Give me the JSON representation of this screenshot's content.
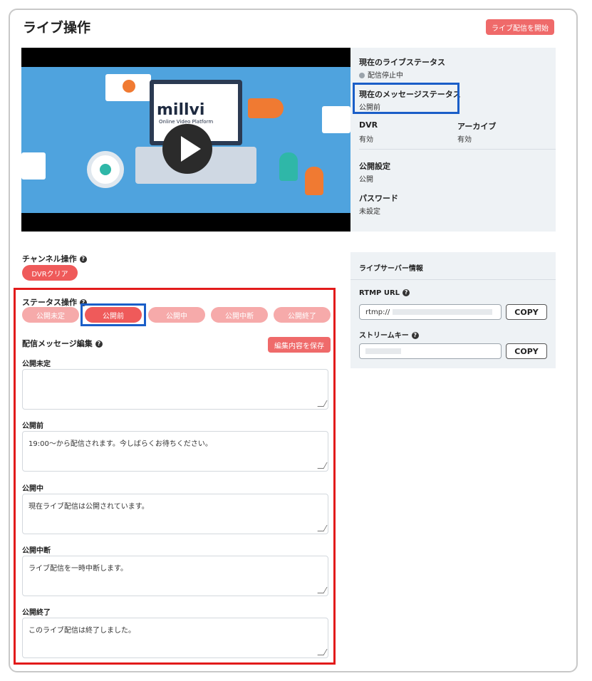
{
  "page": {
    "title": "ライブ操作",
    "start_button": "ライブ配信を開始"
  },
  "video": {
    "brand": "millvi",
    "brand_sub": "Online Video Platform"
  },
  "info": {
    "live_status_label": "現在のライブステータス",
    "live_status_value": "配信停止中",
    "message_status_label": "現在のメッセージステータス",
    "message_status_value": "公開前",
    "dvr_label": "DVR",
    "dvr_value": "有効",
    "archive_label": "アーカイブ",
    "archive_value": "有効",
    "publish_label": "公開設定",
    "publish_value": "公開",
    "password_label": "パスワード",
    "password_value": "未設定"
  },
  "channel": {
    "title": "チャンネル操作",
    "dvr_clear": "DVRクリア"
  },
  "status_ops": {
    "title": "ステータス操作",
    "buttons": [
      "公開未定",
      "公開前",
      "公開中",
      "公開中断",
      "公開終了"
    ]
  },
  "message_edit": {
    "title": "配信メッセージ編集",
    "save_button": "編集内容を保存",
    "fields": [
      {
        "label": "公開未定",
        "value": ""
      },
      {
        "label": "公開前",
        "value": "19:00〜から配信されます。今しばらくお待ちください。"
      },
      {
        "label": "公開中",
        "value": "現在ライブ配信は公開されています。"
      },
      {
        "label": "公開中断",
        "value": "ライブ配信を一時中断します。"
      },
      {
        "label": "公開終了",
        "value": "このライブ配信は終了しました。"
      }
    ]
  },
  "server": {
    "title": "ライブサーバー情報",
    "rtmp_label": "RTMP URL",
    "rtmp_value": "rtmp://",
    "key_label": "ストリームキー",
    "copy": "COPY"
  },
  "colors": {
    "accent": "#ef5a5a",
    "highlight_red": "#e21b1b",
    "highlight_blue": "#1a5ec8"
  }
}
